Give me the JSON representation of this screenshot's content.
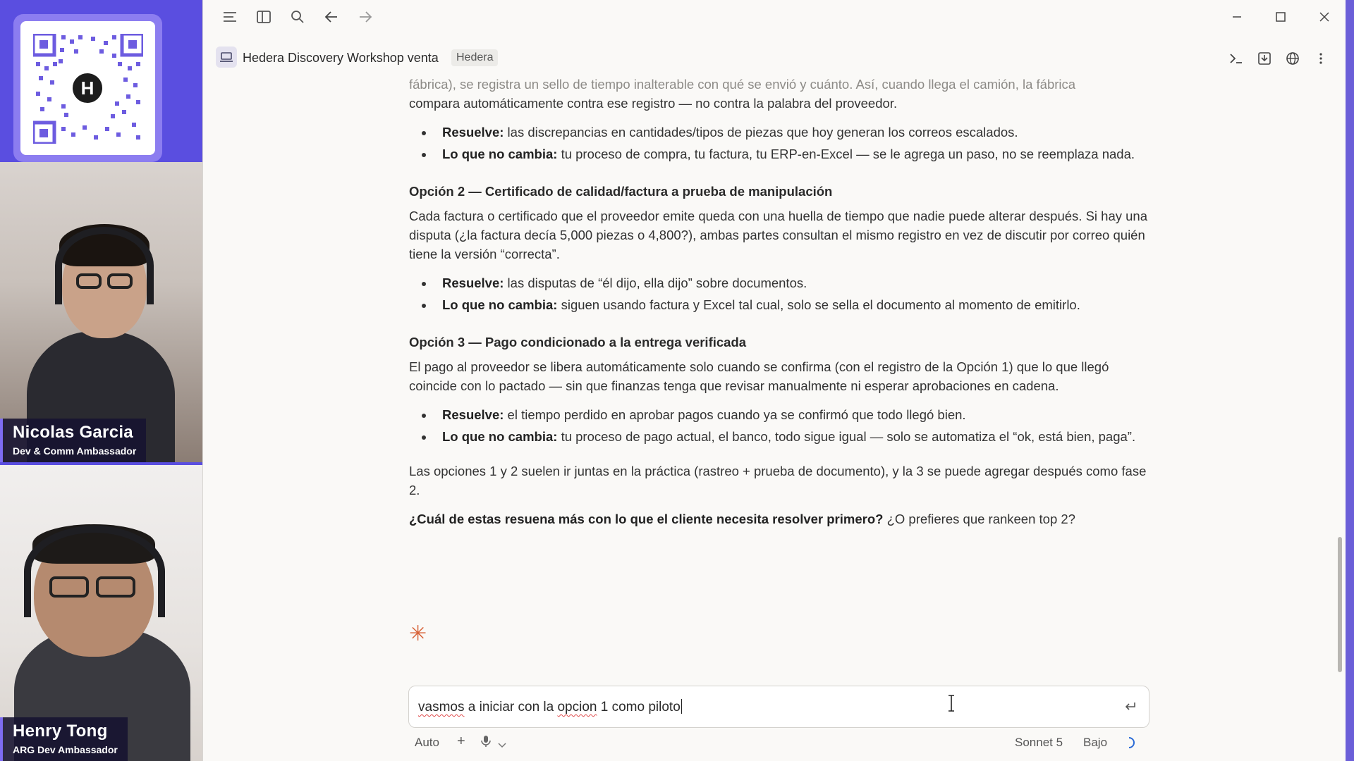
{
  "overlay": {
    "qr_logo": "H",
    "participants": [
      {
        "name": "Nicolas Garcia",
        "role": "Dev & Comm Ambassador"
      },
      {
        "name": "Henry Tong",
        "role": "ARG Dev Ambassador"
      }
    ]
  },
  "window": {
    "title": "Hedera Discovery Workshop venta",
    "badge": "Hedera",
    "icons": {
      "menu": "menu-icon",
      "sidebar": "sidebar-icon",
      "search": "search-icon",
      "back": "arrow-left-icon",
      "forward": "arrow-right-icon",
      "minimize": "minimize-icon",
      "maximize": "maximize-icon",
      "close": "close-icon",
      "terminal": "terminal-icon",
      "export": "export-icon",
      "globe": "globe-icon",
      "more": "more-vertical-icon"
    }
  },
  "message": {
    "intro_faded": "fábrica), se registra un sello de tiempo inalterable con qué se envió y cuánto. Así, cuando llega el camión, la fábrica",
    "intro": "compara automáticamente contra ese registro — no contra la palabra del proveedor.",
    "opt1_bullets": [
      {
        "label": "Resuelve:",
        "text": " las discrepancias en cantidades/tipos de piezas que hoy generan los correos escalados."
      },
      {
        "label": "Lo que no cambia:",
        "text": " tu proceso de compra, tu factura, tu ERP-en-Excel — se le agrega un paso, no se reemplaza nada."
      }
    ],
    "opt2_title": "Opción 2 — Certificado de calidad/factura a prueba de manipulación",
    "opt2_text": "Cada factura o certificado que el proveedor emite queda con una huella de tiempo que nadie puede alterar después. Si hay una disputa (¿la factura decía 5,000 piezas o 4,800?), ambas partes consultan el mismo registro en vez de discutir por correo quién tiene la versión “correcta”.",
    "opt2_bullets": [
      {
        "label": "Resuelve:",
        "text": " las disputas de “él dijo, ella dijo” sobre documentos."
      },
      {
        "label": "Lo que no cambia:",
        "text": " siguen usando factura y Excel tal cual, solo se sella el documento al momento de emitirlo."
      }
    ],
    "opt3_title": "Opción 3 — Pago condicionado a la entrega verificada",
    "opt3_text": "El pago al proveedor se libera automáticamente solo cuando se confirma (con el registro de la Opción 1) que lo que llegó coincide con lo pactado — sin que finanzas tenga que revisar manualmente ni esperar aprobaciones en cadena.",
    "opt3_bullets": [
      {
        "label": "Resuelve:",
        "text": " el tiempo perdido en aprobar pagos cuando ya se confirmó que todo llegó bien."
      },
      {
        "label": "Lo que no cambia:",
        "text": " tu proceso de pago actual, el banco, todo sigue igual — solo se automatiza el “ok, está bien, paga”."
      }
    ],
    "summary": "Las opciones 1 y 2 suelen ir juntas en la práctica (rastreo + prueba de documento), y la 3 se puede agregar después como fase 2.",
    "question_bold": "¿Cuál de estas resuena más con lo que el cliente necesita resolver primero?",
    "question_rest": " ¿O prefieres que rankeen top 2?",
    "spinner_glyph": "✳"
  },
  "composer": {
    "word1": "vasmos",
    "mid": " a iniciar con la ",
    "word2": "opcion",
    "tail": " 1 como piloto",
    "mode": "Auto",
    "add": "+",
    "model": "Sonnet 5",
    "effort": "Bajo"
  },
  "colors": {
    "accent": "#d8643a",
    "overlay_purple": "#5a4ee0",
    "window_bg": "#faf9f7"
  }
}
